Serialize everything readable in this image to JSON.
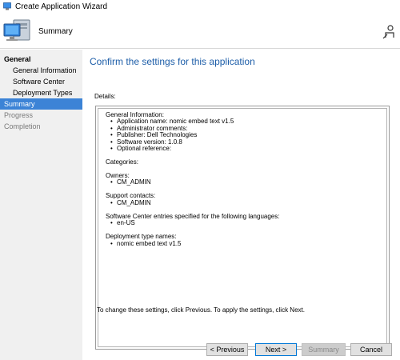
{
  "window": {
    "title": "Create Application Wizard"
  },
  "header": {
    "page_heading": "Summary"
  },
  "sidebar": {
    "items": [
      {
        "label": "General",
        "kind": "group"
      },
      {
        "label": "General Information",
        "kind": "sub"
      },
      {
        "label": "Software Center",
        "kind": "sub"
      },
      {
        "label": "Deployment Types",
        "kind": "sub"
      },
      {
        "label": "Summary",
        "kind": "top",
        "active": true
      },
      {
        "label": "Progress",
        "kind": "top"
      },
      {
        "label": "Completion",
        "kind": "top"
      }
    ]
  },
  "main": {
    "heading": "Confirm the settings for this application",
    "details_label": "Details:",
    "details": {
      "general_information": {
        "header": "General Information:",
        "items": [
          "Application name: nomic embed text v1.5",
          "Administrator comments:",
          "Publisher: Dell Technologies",
          "Software version: 1.0.8",
          "Optional reference:"
        ]
      },
      "categories": {
        "header": "Categories:"
      },
      "owners": {
        "header": "Owners:",
        "items": [
          "CM_ADMIN"
        ]
      },
      "support_contacts": {
        "header": "Support contacts:",
        "items": [
          "CM_ADMIN"
        ]
      },
      "languages": {
        "header": "Software Center entries specified for the following languages:",
        "items": [
          "en-US"
        ]
      },
      "deployment_types": {
        "header": "Deployment type names:",
        "items": [
          "nomic embed text v1.5"
        ]
      }
    },
    "note": "To change these settings, click Previous. To apply the settings, click Next."
  },
  "buttons": {
    "previous": "< Previous",
    "next": "Next >",
    "summary": "Summary",
    "cancel": "Cancel"
  },
  "colors": {
    "accent": "#3c83d6",
    "heading": "#1c5da8",
    "sidebar_bg": "#f0f0f0"
  },
  "icons": {
    "app": "wizard-app-icon",
    "hero": "computer-monitor-icon",
    "help": "help-person-icon"
  }
}
